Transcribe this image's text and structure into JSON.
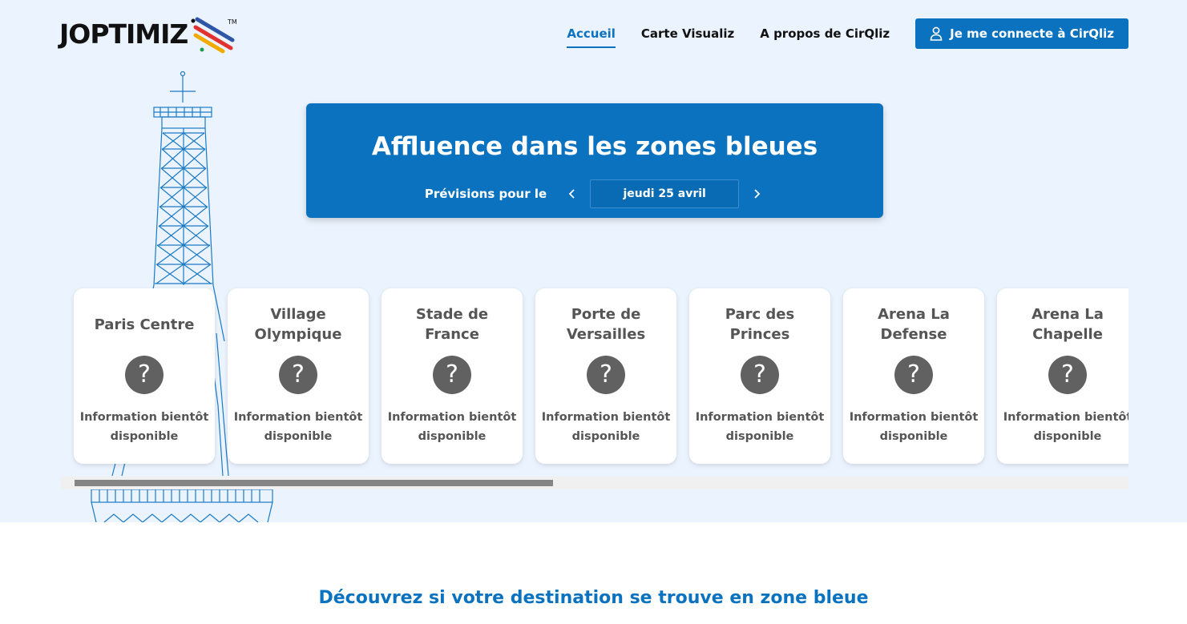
{
  "brand": {
    "name": "JOPTIMIZ",
    "trademark": "TM",
    "stripe_colors": [
      "#2f55a7",
      "#e2322f",
      "#f2a900",
      "#1e9e4a"
    ]
  },
  "nav": {
    "links": [
      {
        "label": "Accueil",
        "active": true
      },
      {
        "label": "Carte Visualiz",
        "active": false
      },
      {
        "label": "A propos de CirQliz",
        "active": false
      }
    ],
    "login_label": "Je me connecte à CirQliz",
    "login_icon": "user-icon"
  },
  "banner": {
    "title": "Affluence dans les zones bleues",
    "forecast_label": "Prévisions pour le",
    "date": "jeudi 25 avril",
    "prev_icon": "chevron-left-icon",
    "next_icon": "chevron-right-icon"
  },
  "zones": [
    {
      "name": "Paris Centre",
      "status_icon": "?",
      "info": "Information bientôt disponible"
    },
    {
      "name": "Village Olympique",
      "status_icon": "?",
      "info": "Information bientôt disponible"
    },
    {
      "name": "Stade de France",
      "status_icon": "?",
      "info": "Information bientôt disponible"
    },
    {
      "name": "Porte de Versailles",
      "status_icon": "?",
      "info": "Information bientôt disponible"
    },
    {
      "name": "Parc des Princes",
      "status_icon": "?",
      "info": "Information bientôt disponible"
    },
    {
      "name": "Arena La Defense",
      "status_icon": "?",
      "info": "Information bientôt disponible"
    },
    {
      "name": "Arena La Chapelle",
      "status_icon": "?",
      "info": "Information bientôt disponible"
    }
  ],
  "carousel": {
    "scroll_position": 0.0,
    "visible_fraction": 0.46
  },
  "discover_heading": "Découvrez si votre destination se trouve en zone bleue",
  "colors": {
    "primary": "#0b72c0",
    "hero_bg": "#ebf3fe",
    "status_unknown": "#616161"
  }
}
